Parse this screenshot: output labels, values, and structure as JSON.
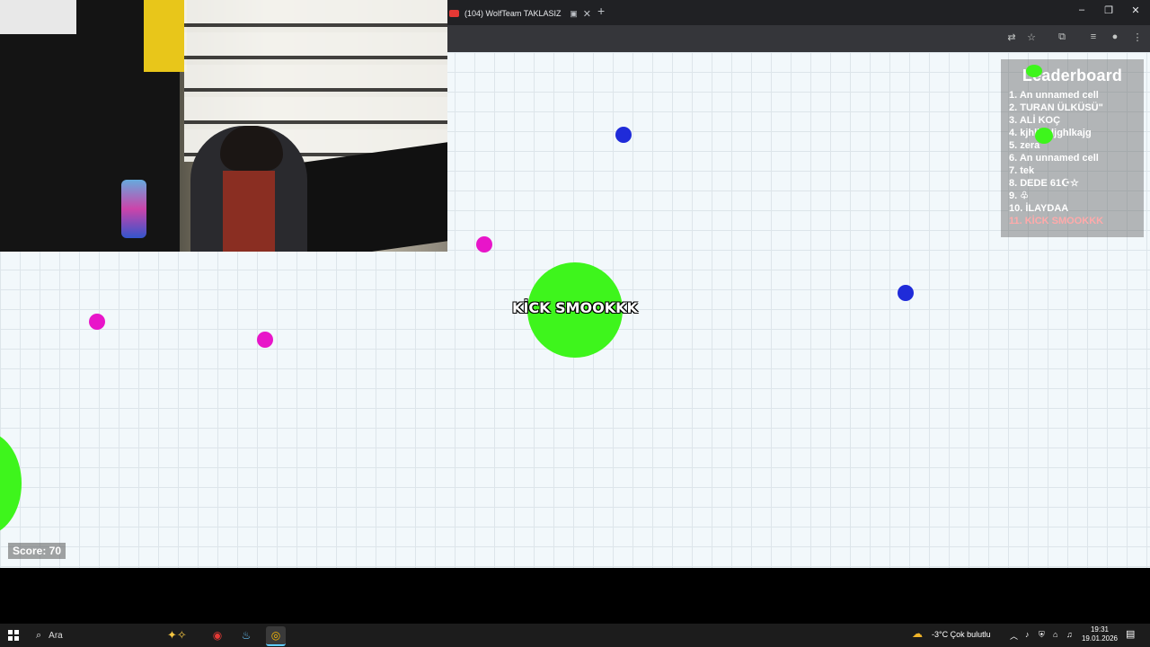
{
  "browser": {
    "tab_title": "(104) WolfTeam TAKLASIZ",
    "tab_audio_icon": "camera-icon",
    "tab_close_icon": "close-icon",
    "new_tab_glyph": "+",
    "window_controls": [
      "–",
      "❐",
      "✕"
    ]
  },
  "game": {
    "player_name": "KİCK SMOOKKK",
    "score_label": "Score: 70",
    "pellet_colors": [
      "#1f2bd9",
      "#e815c9"
    ],
    "player_color": "#3ef51c"
  },
  "leaderboard": {
    "title": "Leaderboard",
    "entries": [
      "1. An unnamed cell",
      "2. TURAN ÜLKÜSÜ\"",
      "3. ALİ KOÇ",
      "4. kjhlksdjghlkajg",
      "5. zera",
      "6. An unnamed cell",
      "7. tek",
      "8. DEDE 61☪☆",
      "9. ♧",
      "10. İLAYDAA",
      "11. KİCK SMOOKKK"
    ],
    "self_color": "#ffaaaa"
  },
  "taskbar": {
    "search_placeholder": "Ara",
    "weather": "-3°C  Çok bulutlu",
    "time": "19:31",
    "date": "19.01.2026"
  }
}
